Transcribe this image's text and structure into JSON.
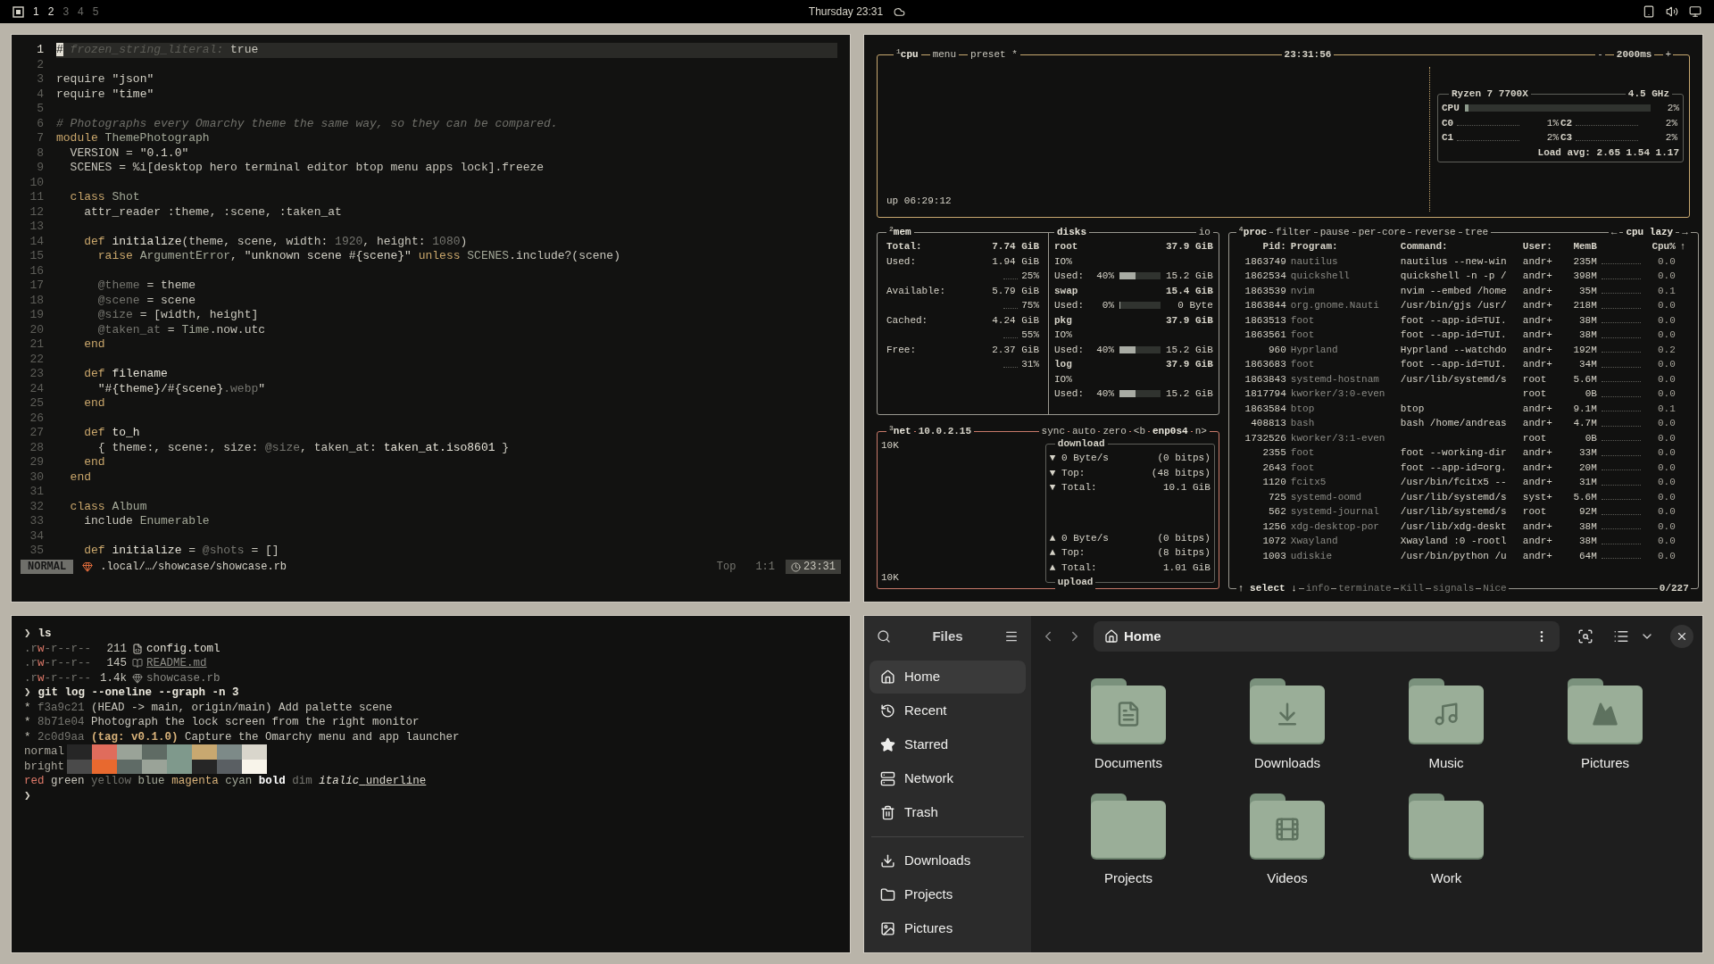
{
  "top_bar": {
    "workspaces": [
      {
        "label": "1",
        "occupied": true
      },
      {
        "label": "2",
        "occupied": true
      },
      {
        "label": "3",
        "occupied": false
      },
      {
        "label": "4",
        "occupied": false
      },
      {
        "label": "5",
        "occupied": false
      }
    ],
    "clock": "Thursday 23:31"
  },
  "editor": {
    "lines": [
      {
        "n": "1",
        "current": true,
        "segs": [
          {
            "kind": "cursor",
            "t": "#"
          },
          {
            "kind": "faint",
            "t": " frozen_string_literal:"
          },
          {
            "kind": "plain",
            "t": " true"
          }
        ]
      },
      {
        "n": "2",
        "current": false
      },
      {
        "n": "3",
        "current": false,
        "segs": [
          {
            "kind": "plain",
            "t": "require "
          },
          {
            "kind": "str",
            "t": "\"json\""
          }
        ]
      },
      {
        "n": "4",
        "current": false,
        "segs": [
          {
            "kind": "plain",
            "t": "require "
          },
          {
            "kind": "str",
            "t": "\"time\""
          }
        ]
      },
      {
        "n": "5",
        "current": false
      },
      {
        "n": "6",
        "current": false,
        "segs": [
          {
            "kind": "com",
            "t": "# Photographs every Omarchy theme the same way, so they can be compared."
          }
        ]
      },
      {
        "n": "7",
        "current": false,
        "segs": [
          {
            "kind": "kw",
            "t": "module "
          },
          {
            "kind": "const",
            "t": "ThemePhotograph"
          }
        ]
      },
      {
        "n": "8",
        "current": false,
        "segs": [
          {
            "kind": "plain",
            "t": "  VERSION = "
          },
          {
            "kind": "str",
            "t": "\"0.1.0\""
          }
        ]
      },
      {
        "n": "9",
        "current": false,
        "segs": [
          {
            "kind": "plain",
            "t": "  SCENES = %i[desktop hero terminal editor btop menu apps lock].freeze"
          }
        ]
      },
      {
        "n": "10",
        "current": false
      },
      {
        "n": "11",
        "current": false,
        "segs": [
          {
            "kind": "kw",
            "t": "  class "
          },
          {
            "kind": "const",
            "t": "Shot"
          }
        ]
      },
      {
        "n": "12",
        "current": false,
        "segs": [
          {
            "kind": "plain",
            "t": "    attr_reader :theme, :scene, :taken_at"
          }
        ]
      },
      {
        "n": "13",
        "current": false
      },
      {
        "n": "14",
        "current": false,
        "segs": [
          {
            "kind": "kw",
            "t": "    def "
          },
          {
            "kind": "fn",
            "t": "initialize"
          },
          {
            "kind": "plain",
            "t": "(theme, scene, width: "
          },
          {
            "kind": "num",
            "t": "1920"
          },
          {
            "kind": "plain",
            "t": ", height: "
          },
          {
            "kind": "num",
            "t": "1080"
          },
          {
            "kind": "plain",
            "t": ")"
          }
        ]
      },
      {
        "n": "15",
        "current": false,
        "segs": [
          {
            "kind": "kw",
            "t": "      raise "
          },
          {
            "kind": "const",
            "t": "ArgumentError"
          },
          {
            "kind": "plain",
            "t": ", "
          },
          {
            "kind": "str",
            "t": "\"unknown scene #{scene}\""
          },
          {
            "kind": "kw",
            "t": " unless "
          },
          {
            "kind": "const",
            "t": "SCENES"
          },
          {
            "kind": "plain",
            "t": ".include?(scene)"
          }
        ]
      },
      {
        "n": "16",
        "current": false
      },
      {
        "n": "17",
        "current": false,
        "segs": [
          {
            "kind": "ivar",
            "t": "      @theme"
          },
          {
            "kind": "plain",
            "t": " = theme"
          }
        ]
      },
      {
        "n": "18",
        "current": false,
        "segs": [
          {
            "kind": "ivar",
            "t": "      @scene"
          },
          {
            "kind": "plain",
            "t": " = scene"
          }
        ]
      },
      {
        "n": "19",
        "current": false,
        "segs": [
          {
            "kind": "ivar",
            "t": "      @size"
          },
          {
            "kind": "plain",
            "t": " = [width, height]"
          }
        ]
      },
      {
        "n": "20",
        "current": false,
        "segs": [
          {
            "kind": "ivar",
            "t": "      @taken_at"
          },
          {
            "kind": "plain",
            "t": " = "
          },
          {
            "kind": "const",
            "t": "Time"
          },
          {
            "kind": "plain",
            "t": ".now.utc"
          }
        ]
      },
      {
        "n": "21",
        "current": false,
        "segs": [
          {
            "kind": "kw",
            "t": "    end"
          }
        ]
      },
      {
        "n": "22",
        "current": false
      },
      {
        "n": "23",
        "current": false,
        "segs": [
          {
            "kind": "kw",
            "t": "    def "
          },
          {
            "kind": "fn",
            "t": "filename"
          }
        ]
      },
      {
        "n": "24",
        "current": false,
        "segs": [
          {
            "kind": "str",
            "t": "      \"#{theme}/#{scene}"
          },
          {
            "kind": "ivar",
            "t": ".webp"
          },
          {
            "kind": "str",
            "t": "\""
          }
        ]
      },
      {
        "n": "25",
        "current": false,
        "segs": [
          {
            "kind": "kw",
            "t": "    end"
          }
        ]
      },
      {
        "n": "26",
        "current": false
      },
      {
        "n": "27",
        "current": false,
        "segs": [
          {
            "kind": "kw",
            "t": "    def "
          },
          {
            "kind": "fn",
            "t": "to_h"
          }
        ]
      },
      {
        "n": "28",
        "current": false,
        "segs": [
          {
            "kind": "plain",
            "t": "      { theme:, scene:, size: "
          },
          {
            "kind": "ivar",
            "t": "@size"
          },
          {
            "kind": "plain",
            "t": ", taken_at: "
          },
          {
            "kind": "fn",
            "t": "taken_at.iso8601"
          },
          {
            "kind": "plain",
            "t": " }"
          }
        ]
      },
      {
        "n": "29",
        "current": false,
        "segs": [
          {
            "kind": "kw",
            "t": "    end"
          }
        ]
      },
      {
        "n": "30",
        "current": false,
        "segs": [
          {
            "kind": "kw",
            "t": "  end"
          }
        ]
      },
      {
        "n": "31",
        "current": false
      },
      {
        "n": "32",
        "current": false,
        "segs": [
          {
            "kind": "kw",
            "t": "  class "
          },
          {
            "kind": "const",
            "t": "Album"
          }
        ]
      },
      {
        "n": "33",
        "current": false,
        "segs": [
          {
            "kind": "plain",
            "t": "    include "
          },
          {
            "kind": "const",
            "t": "Enumerable"
          }
        ]
      },
      {
        "n": "34",
        "current": false
      },
      {
        "n": "35",
        "current": false,
        "segs": [
          {
            "kind": "kw",
            "t": "    def "
          },
          {
            "kind": "fn",
            "t": "initialize"
          },
          {
            "kind": "plain",
            "t": " = "
          },
          {
            "kind": "ivar",
            "t": "@shots"
          },
          {
            "kind": "plain",
            "t": " = []"
          }
        ]
      }
    ],
    "status": {
      "mode": "NORMAL",
      "file": ".local/…/showcase/showcase.rb",
      "scroll": "Top",
      "position": "1:1",
      "clock": "23:31"
    }
  },
  "btop": {
    "cpu": {
      "index": "1",
      "tabs": [
        "cpu",
        "menu",
        "preset *"
      ],
      "clock": "23:31:56",
      "minus": "-",
      "interval": "2000ms",
      "plus": "+",
      "uptime": "up 06:29:12",
      "model": "Ryzen 7 7700X",
      "freq": "4.5 GHz",
      "total": {
        "label": "CPU",
        "level": 0.02,
        "percent": "2%"
      },
      "cores": [
        {
          "label": "C0",
          "percent": "1%"
        },
        {
          "label": "C2",
          "percent": "2%"
        },
        {
          "label": "C1",
          "percent": "2%"
        },
        {
          "label": "C3",
          "percent": "2%"
        }
      ],
      "load": "Load avg: 2.65 1.54 1.17"
    },
    "mem": {
      "index": "2",
      "title": "mem",
      "rows": [
        {
          "label": "Total:",
          "value": "7.74 GiB"
        },
        {
          "label": "Used:",
          "value": "1.94 GiB",
          "percent": "25%"
        },
        {
          "label": "Available:",
          "value": "5.79 GiB",
          "percent": "75%"
        },
        {
          "label": "Cached:",
          "value": "4.24 GiB",
          "percent": "55%"
        },
        {
          "label": "Free:",
          "value": "2.37 GiB",
          "percent": "31%"
        }
      ]
    },
    "disks": {
      "title": "disks",
      "io": "io",
      "items": [
        {
          "name": "root",
          "size": "37.9 GiB",
          "io": "IO%",
          "used_label": "Used:",
          "used_pct": "40%",
          "level": 0.4,
          "used": "15.2 GiB"
        },
        {
          "name": "swap",
          "size": "15.4 GiB",
          "used_label": "Used:",
          "used_pct": "0%",
          "level": 0,
          "used": "0 Byte"
        },
        {
          "name": "pkg",
          "size": "37.9 GiB",
          "io": "IO%",
          "used_label": "Used:",
          "used_pct": "40%",
          "level": 0.4,
          "used": "15.2 GiB"
        },
        {
          "name": "log",
          "size": "37.9 GiB",
          "io": "IO%",
          "used_label": "Used:",
          "used_pct": "40%",
          "level": 0.4,
          "used": "15.2 GiB"
        }
      ]
    },
    "net": {
      "index": "3",
      "title": "net",
      "address": "10.0.2.15",
      "buttons": [
        "sync",
        "auto",
        "zero",
        "<b",
        "enp0s4",
        "n>"
      ],
      "scale_top": "10K",
      "scale_bottom": "10K",
      "download_title": "download",
      "upload_title": "upload",
      "download": [
        {
          "arrow": "▼",
          "label": "0 Byte/s",
          "value": "(0 bitps)"
        },
        {
          "arrow": "▼",
          "label": "Top:",
          "value": "(48 bitps)"
        },
        {
          "arrow": "▼",
          "label": "Total:",
          "value": "10.1 GiB"
        }
      ],
      "upload": [
        {
          "arrow": "▲",
          "label": "0 Byte/s",
          "value": "(0 bitps)"
        },
        {
          "arrow": "▲",
          "label": "Top:",
          "value": "(8 bitps)"
        },
        {
          "arrow": "▲",
          "label": "Total:",
          "value": "1.01 GiB"
        }
      ]
    },
    "proc": {
      "index": "4",
      "title": "proc",
      "buttons": [
        "filter",
        "pause",
        "per-core",
        "reverse",
        "tree"
      ],
      "left": "←",
      "sort": "cpu lazy",
      "right": "→",
      "columns": [
        "Pid:",
        "Program:",
        "Command:",
        "User:",
        "MemB",
        "Cpu%",
        "↑"
      ],
      "rows": [
        {
          "pid": "1863749",
          "program": "nautilus",
          "command": "nautilus --new-win",
          "user": "andr+",
          "mem": "235M",
          "cpu": "0.0"
        },
        {
          "pid": "1862534",
          "program": "quickshell",
          "command": "quickshell -n -p /",
          "user": "andr+",
          "mem": "398M",
          "cpu": "0.0"
        },
        {
          "pid": "1863539",
          "program": "nvim",
          "command": "nvim --embed /home",
          "user": "andr+",
          "mem": "35M",
          "cpu": "0.1"
        },
        {
          "pid": "1863844",
          "program": "org.gnome.Nauti",
          "command": "/usr/bin/gjs /usr/",
          "user": "andr+",
          "mem": "218M",
          "cpu": "0.0"
        },
        {
          "pid": "1863513",
          "program": "foot",
          "command": "foot --app-id=TUI.",
          "user": "andr+",
          "mem": "38M",
          "cpu": "0.0"
        },
        {
          "pid": "1863561",
          "program": "foot",
          "command": "foot --app-id=TUI.",
          "user": "andr+",
          "mem": "38M",
          "cpu": "0.0"
        },
        {
          "pid": "960",
          "program": "Hyprland",
          "command": "Hyprland --watchdo",
          "user": "andr+",
          "mem": "192M",
          "cpu": "0.2"
        },
        {
          "pid": "1863683",
          "program": "foot",
          "command": "foot --app-id=TUI.",
          "user": "andr+",
          "mem": "34M",
          "cpu": "0.0"
        },
        {
          "pid": "1863843",
          "program": "systemd-hostnam",
          "command": "/usr/lib/systemd/s",
          "user": "root",
          "mem": "5.6M",
          "cpu": "0.0"
        },
        {
          "pid": "1817794",
          "program": "kworker/3:0-even",
          "user": "root",
          "mem": "0B",
          "cpu": "0.0"
        },
        {
          "pid": "1863584",
          "program": "btop",
          "command": "btop",
          "user": "andr+",
          "mem": "9.1M",
          "cpu": "0.1"
        },
        {
          "pid": "408813",
          "program": "bash",
          "command": "bash /home/andreas",
          "user": "andr+",
          "mem": "4.7M",
          "cpu": "0.0"
        },
        {
          "pid": "1732526",
          "program": "kworker/3:1-even",
          "user": "root",
          "mem": "0B",
          "cpu": "0.0"
        },
        {
          "pid": "2355",
          "program": "foot",
          "command": "foot --working-dir",
          "user": "andr+",
          "mem": "33M",
          "cpu": "0.0"
        },
        {
          "pid": "2643",
          "program": "foot",
          "command": "foot --app-id=org.",
          "user": "andr+",
          "mem": "20M",
          "cpu": "0.0"
        },
        {
          "pid": "1120",
          "program": "fcitx5",
          "command": "/usr/bin/fcitx5 --",
          "user": "andr+",
          "mem": "31M",
          "cpu": "0.0"
        },
        {
          "pid": "725",
          "program": "systemd-oomd",
          "command": "/usr/lib/systemd/s",
          "user": "syst+",
          "mem": "5.6M",
          "cpu": "0.0"
        },
        {
          "pid": "562",
          "program": "systemd-journal",
          "command": "/usr/lib/systemd/s",
          "user": "root",
          "mem": "92M",
          "cpu": "0.0"
        },
        {
          "pid": "1256",
          "program": "xdg-desktop-por",
          "command": "/usr/lib/xdg-deskt",
          "user": "andr+",
          "mem": "38M",
          "cpu": "0.0"
        },
        {
          "pid": "1072",
          "program": "Xwayland",
          "command": "Xwayland :0 -rootl",
          "user": "andr+",
          "mem": "38M",
          "cpu": "0.0"
        },
        {
          "pid": "1003",
          "program": "udiskie",
          "command": "/usr/bin/python /u",
          "user": "andr+",
          "mem": "64M",
          "cpu": "0.0"
        }
      ],
      "footer": [
        "↑ select ↓",
        "info",
        "terminate",
        "Kill",
        "signals",
        "Nice"
      ],
      "count": "0/227"
    }
  },
  "terminal": {
    "lines": [
      {
        "kind": "command",
        "prompt": "❯",
        "text": "ls"
      },
      {
        "kind": "file",
        "perms": [
          {
            "kind": "dim",
            "t": ".r"
          },
          {
            "kind": "write",
            "t": "w"
          },
          {
            "kind": "dim",
            "t": "-r--r--"
          }
        ],
        "size": "211",
        "entry": {
          "kind": "config",
          "name": "config.toml",
          "underline": false
        }
      },
      {
        "kind": "file",
        "perms": [
          {
            "kind": "dim",
            "t": ".r"
          },
          {
            "kind": "write",
            "t": "w"
          },
          {
            "kind": "dim",
            "t": "-r--r--"
          }
        ],
        "size": "145",
        "entry": {
          "kind": "markdown",
          "name": "README.md",
          "underline": true
        }
      },
      {
        "kind": "file",
        "perms": [
          {
            "kind": "dim",
            "t": ".r"
          },
          {
            "kind": "write",
            "t": "w"
          },
          {
            "kind": "dim",
            "t": "-r--r--"
          }
        ],
        "size": "1.4k",
        "entry": {
          "kind": "ruby",
          "name": "showcase.rb",
          "underline": false
        }
      },
      {
        "kind": "command",
        "prompt": "❯",
        "text": "git log --oneline --graph -n 3"
      },
      {
        "kind": "commit",
        "segs": [
          {
            "kind": "plain",
            "t": "* "
          },
          {
            "kind": "dim",
            "t": "f3a9c21 "
          },
          {
            "kind": "plain",
            "t": "(HEAD -> main, origin/main) Add palette scene"
          }
        ]
      },
      {
        "kind": "commit",
        "segs": [
          {
            "kind": "plain",
            "t": "* "
          },
          {
            "kind": "dim",
            "t": "8b71e04 "
          },
          {
            "kind": "plain",
            "t": "Photograph the lock screen from the right monitor"
          }
        ]
      },
      {
        "kind": "commit",
        "segs": [
          {
            "kind": "plain",
            "t": "* "
          },
          {
            "kind": "dim",
            "t": "2c0d9aa "
          },
          {
            "kind": "tag",
            "t": "(tag: v0.1.0)"
          },
          {
            "kind": "plain",
            "t": " Capture the Omarchy menu and app launcher"
          }
        ]
      },
      {
        "kind": "palette",
        "label": "normal",
        "swatches": [
          {
            "color": "#262626"
          },
          {
            "color": "#e06c5c"
          },
          {
            "color": "#9aa398"
          },
          {
            "color": "#5f6b64"
          },
          {
            "color": "#7f998c"
          },
          {
            "color": "#c8a870"
          },
          {
            "color": "#7d8a88"
          },
          {
            "color": "#d9d6cc"
          }
        ]
      },
      {
        "kind": "palette",
        "label": "bright",
        "swatches": [
          {
            "color": "#4a4a4a"
          },
          {
            "color": "#e8692f"
          },
          {
            "color": "#5f6b66"
          },
          {
            "color": "#9aa398"
          },
          {
            "color": "#7f998c"
          },
          {
            "color": "#262626"
          },
          {
            "color": "#5a5f63"
          },
          {
            "color": "#f8f4ea"
          }
        ]
      },
      {
        "kind": "styles",
        "segs": [
          {
            "kind": "red",
            "t": "red"
          },
          {
            "kind": "green",
            "t": "green"
          },
          {
            "kind": "yellow",
            "t": "yellow"
          },
          {
            "kind": "blue",
            "t": "blue"
          },
          {
            "kind": "magenta",
            "t": "magenta"
          },
          {
            "kind": "cyan",
            "t": "cyan"
          },
          {
            "kind": "bold",
            "t": "bold"
          },
          {
            "kind": "dim",
            "t": "dim"
          },
          {
            "kind": "italic",
            "t": "italic"
          },
          {
            "kind": "underline",
            "t": "underline"
          }
        ]
      },
      {
        "kind": "command",
        "prompt": "❯"
      }
    ]
  },
  "files": {
    "title": "Files",
    "path": "Home",
    "places": [
      {
        "kind": "home",
        "label": "Home",
        "selected": true
      },
      {
        "kind": "recent",
        "label": "Recent",
        "selected": false
      },
      {
        "kind": "starred",
        "label": "Starred",
        "selected": false
      },
      {
        "kind": "network",
        "label": "Network",
        "selected": false
      },
      {
        "kind": "trash",
        "label": "Trash",
        "selected": false
      }
    ],
    "bookmarks": [
      {
        "kind": "downloads",
        "label": "Downloads",
        "selected": false
      },
      {
        "kind": "folder",
        "label": "Projects",
        "selected": false
      },
      {
        "kind": "pictures",
        "label": "Pictures",
        "selected": false
      }
    ],
    "folders": [
      {
        "kind": "documents",
        "label": "Documents"
      },
      {
        "kind": "downloads",
        "label": "Downloads"
      },
      {
        "kind": "music",
        "label": "Music"
      },
      {
        "kind": "pictures",
        "label": "Pictures"
      },
      {
        "kind": "plain",
        "label": "Projects"
      },
      {
        "kind": "videos",
        "label": "Videos"
      },
      {
        "kind": "plain",
        "label": "Work"
      }
    ]
  }
}
